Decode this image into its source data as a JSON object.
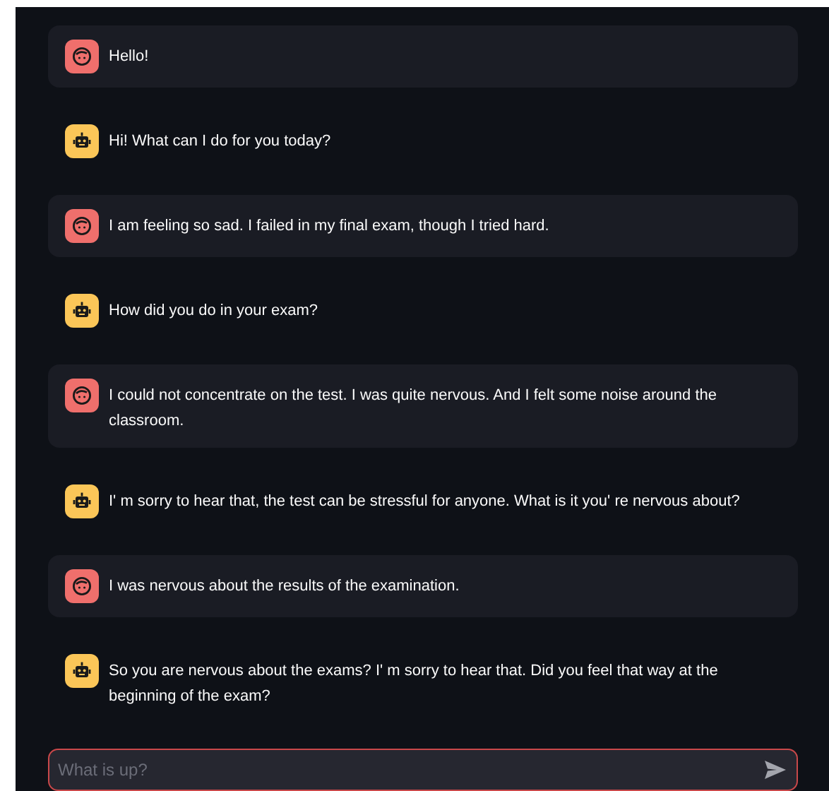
{
  "messages": [
    {
      "kind": "user",
      "text": "Hello!"
    },
    {
      "kind": "assistant",
      "text": "Hi! What can I do for you today?"
    },
    {
      "kind": "user",
      "text": "I am feeling so sad. I failed in my final exam, though I tried hard."
    },
    {
      "kind": "assistant",
      "text": "How did you do in your exam?"
    },
    {
      "kind": "user",
      "text": "I could not concentrate on the test. I was quite nervous. And I felt some noise around the classroom."
    },
    {
      "kind": "assistant",
      "text": "I' m sorry to hear that, the test can be stressful for anyone. What is it you' re nervous about?"
    },
    {
      "kind": "user",
      "text": "I was nervous about the results of the examination."
    },
    {
      "kind": "assistant",
      "text": "So you are nervous about the exams? I' m sorry to hear that. Did you feel that way at the beginning of the exam?"
    }
  ],
  "chat_input": {
    "placeholder": "What is up?"
  }
}
